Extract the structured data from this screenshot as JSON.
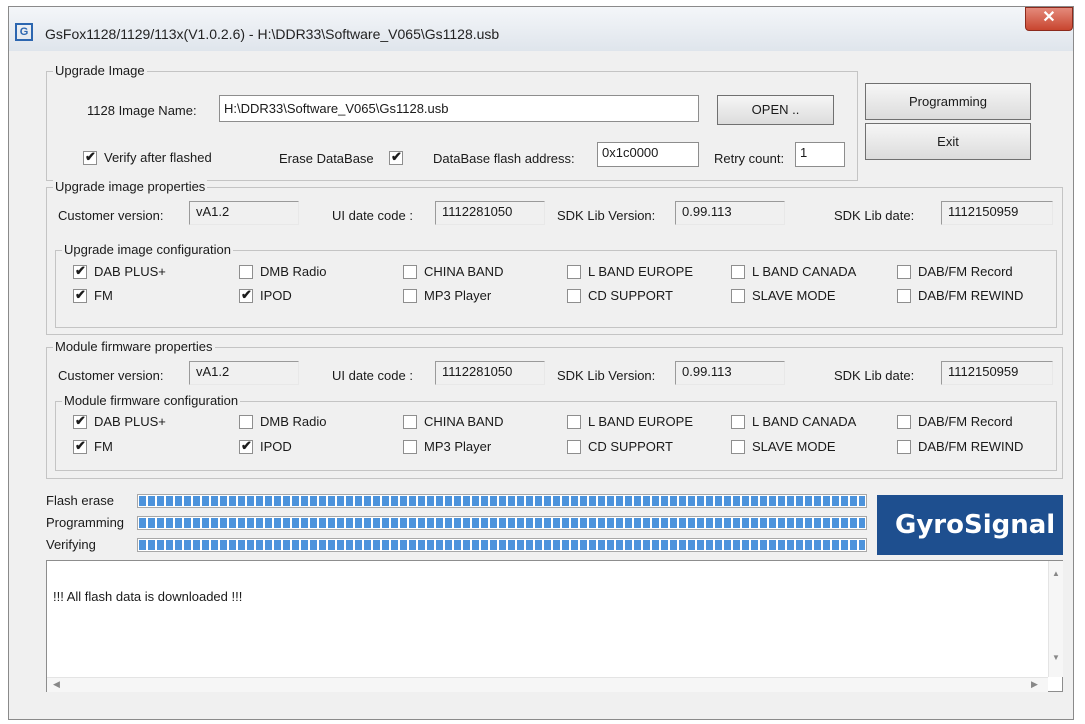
{
  "window": {
    "title": "GsFox1128/1129/113x(V1.0.2.6) - H:\\DDR33\\Software_V065\\Gs1128.usb",
    "close": "✕"
  },
  "upgrade_image": {
    "legend": "Upgrade Image",
    "name_label": "1128 Image Name:",
    "name_value": "H:\\DDR33\\Software_V065\\Gs1128.usb",
    "open_button": "OPEN ..",
    "verify_label": "Verify after flashed",
    "verify_checked": true,
    "erase_label": "Erase DataBase",
    "erase_checked": true,
    "db_addr_label": "DataBase flash address:",
    "db_addr_value": "0x1c0000",
    "retry_label": "Retry count:",
    "retry_value": "1"
  },
  "buttons": {
    "programming": "Programming",
    "exit": "Exit"
  },
  "upgrade_props": {
    "legend": "Upgrade image properties",
    "customer_label": "Customer version:",
    "customer_value": "vA1.2",
    "ui_label": "UI date code :",
    "ui_value": "1112281050",
    "sdk_label": "SDK Lib Version:",
    "sdk_value": "0.99.113",
    "sdkdate_label": "SDK Lib date:",
    "sdkdate_value": "1112150959",
    "config_legend": "Upgrade image configuration",
    "options": [
      {
        "label": "DAB PLUS+",
        "checked": true
      },
      {
        "label": "DMB Radio",
        "checked": false
      },
      {
        "label": "CHINA BAND",
        "checked": false
      },
      {
        "label": "L BAND EUROPE",
        "checked": false
      },
      {
        "label": "L BAND CANADA",
        "checked": false
      },
      {
        "label": "DAB/FM Record",
        "checked": false
      },
      {
        "label": "FM",
        "checked": true
      },
      {
        "label": "IPOD",
        "checked": true
      },
      {
        "label": "MP3 Player",
        "checked": false
      },
      {
        "label": "CD SUPPORT",
        "checked": false
      },
      {
        "label": "SLAVE MODE",
        "checked": false
      },
      {
        "label": "DAB/FM REWIND",
        "checked": false
      }
    ]
  },
  "module_props": {
    "legend": "Module firmware properties",
    "customer_label": "Customer version:",
    "customer_value": "vA1.2",
    "ui_label": "UI date code :",
    "ui_value": "1112281050",
    "sdk_label": "SDK Lib Version:",
    "sdk_value": "0.99.113",
    "sdkdate_label": "SDK Lib date:",
    "sdkdate_value": "1112150959",
    "config_legend": "Module firmware configuration",
    "options": [
      {
        "label": "DAB PLUS+",
        "checked": true
      },
      {
        "label": "DMB Radio",
        "checked": false
      },
      {
        "label": "CHINA BAND",
        "checked": false
      },
      {
        "label": "L BAND EUROPE",
        "checked": false
      },
      {
        "label": "L BAND CANADA",
        "checked": false
      },
      {
        "label": "DAB/FM Record",
        "checked": false
      },
      {
        "label": "FM",
        "checked": true
      },
      {
        "label": "IPOD",
        "checked": true
      },
      {
        "label": "MP3 Player",
        "checked": false
      },
      {
        "label": "CD SUPPORT",
        "checked": false
      },
      {
        "label": "SLAVE MODE",
        "checked": false
      },
      {
        "label": "DAB/FM REWIND",
        "checked": false
      }
    ]
  },
  "progress": [
    {
      "label": "Flash erase",
      "fraction": 1.0
    },
    {
      "label": "Programming",
      "fraction": 1.0
    },
    {
      "label": "Verifying",
      "fraction": 1.0
    }
  ],
  "logo": {
    "text": "GyroSignal"
  },
  "log": {
    "text": "!!! All flash data is downloaded !!!"
  },
  "colors": {
    "progress": "#4c93dc",
    "logo_bg": "#1e4f8f",
    "close": "#c8452f"
  },
  "icons": {
    "app": "app-logo-icon",
    "check": "✔"
  }
}
